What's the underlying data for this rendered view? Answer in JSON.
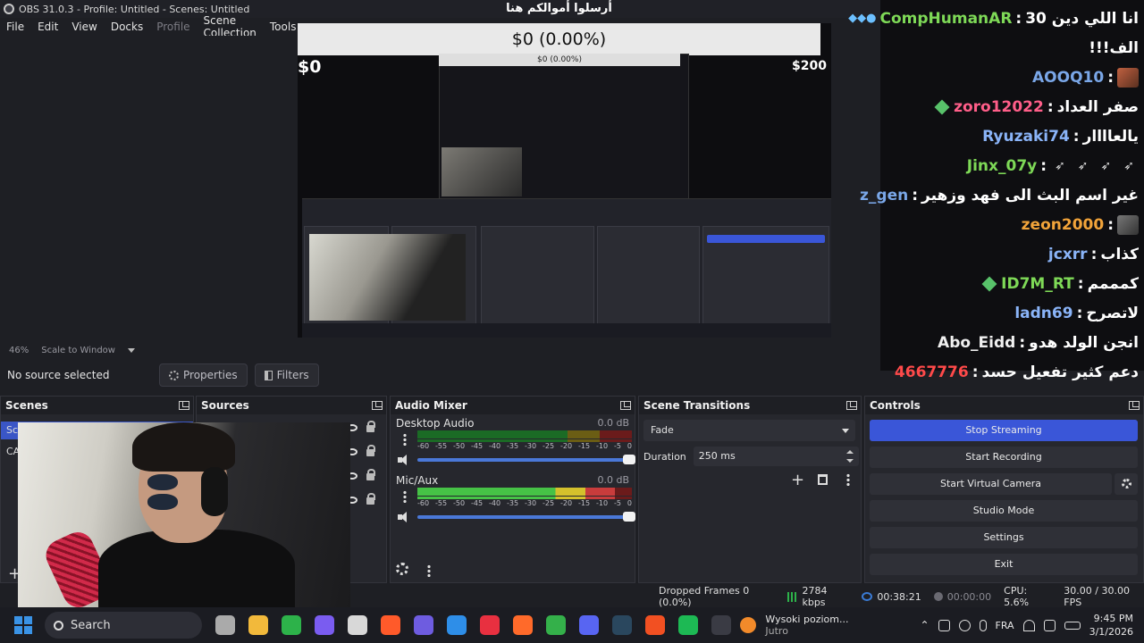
{
  "window": {
    "title": "OBS 31.0.3 - Profile: Untitled - Scenes: Untitled"
  },
  "menu": [
    "File",
    "Edit",
    "View",
    "Docks",
    "Profile",
    "Scene Collection",
    "Tools"
  ],
  "preview": {
    "donation_title": "أرسلوا أموالكم هنا",
    "donation_amount": "$0 (0.00%)",
    "min_label": "$0",
    "max_label": "$200",
    "nested_amount": "$0 (0.00%)",
    "nested_min": "$0"
  },
  "chat": [
    {
      "user": "CompHumanAR",
      "message": "انا اللي دين 30",
      "user_color": "#7ed957",
      "badges": true
    },
    {
      "user": "",
      "message": "!!!الف",
      "user_color": "#ffffff"
    },
    {
      "user": "AOOQ10",
      "message": "",
      "user_color": "#7aa7e8",
      "emote": true
    },
    {
      "user": "zoro12022",
      "message": "صفر العداد",
      "user_color": "#ff5e89",
      "gem": true
    },
    {
      "user": "Ryuzaki74",
      "message": "يالعاااار",
      "user_color": "#8ab4f8"
    },
    {
      "user": "Jinx_07y",
      "message": "",
      "user_color": "#7ed957",
      "feathers": true
    },
    {
      "user": "z_gen",
      "message": "غير اسم البث الى فهد وزهير",
      "user_color": "#7aa7e8"
    },
    {
      "user": "zeon2000",
      "message": "",
      "user_color": "#f2a43a",
      "emote_grey": true
    },
    {
      "user": "jcxrr",
      "message": "كذاب",
      "user_color": "#8ab4f8"
    },
    {
      "user": "ID7M_RT",
      "message": "كمممم",
      "user_color": "#7ed957",
      "gem": true
    },
    {
      "user": "ladn69",
      "message": "لاتصرح",
      "user_color": "#8ab4f8"
    },
    {
      "user": "Abo_Eidd",
      "message": "انجن الولد هدو",
      "user_color": "#f0f0f0"
    },
    {
      "user": "4667776",
      "message": "دعم كثير تفعيل حسد",
      "user_color": "#ff4a4a"
    }
  ],
  "zoom": {
    "percent": "46%",
    "mode": "Scale to Window"
  },
  "context": {
    "label": "No source selected",
    "properties": "Properties",
    "filters": "Filters"
  },
  "docks": {
    "scenes": {
      "title": "Scenes",
      "items": [
        "Sc",
        "CA"
      ]
    },
    "sources": {
      "title": "Sources"
    },
    "mixer": {
      "title": "Audio Mixer",
      "channels": [
        {
          "name": "Desktop Audio",
          "db": "0.0 dB",
          "level": 0.0
        },
        {
          "name": "Mic/Aux",
          "db": "0.0 dB",
          "level": 0.92
        }
      ],
      "scale": [
        "-60",
        "-55",
        "-50",
        "-45",
        "-40",
        "-35",
        "-30",
        "-25",
        "-20",
        "-15",
        "-10",
        "-5",
        "0"
      ]
    },
    "transitions": {
      "title": "Scene Transitions",
      "type": "Fade",
      "duration_label": "Duration",
      "duration": "250 ms"
    },
    "controls": {
      "title": "Controls",
      "buttons": [
        "Stop Streaming",
        "Start Recording",
        "Start Virtual Camera",
        "Studio Mode",
        "Settings",
        "Exit"
      ]
    }
  },
  "status": {
    "dropped": "Dropped Frames 0 (0.0%)",
    "bitrate": "2784 kbps",
    "live_time": "00:38:21",
    "rec_time": "00:00:00",
    "cpu": "CPU: 5.6%",
    "fps": "30.00 / 30.00 FPS"
  },
  "taskbar": {
    "search": "Search",
    "weather_line1": "Wysoki poziom...",
    "weather_line2": "Jutro",
    "lang": "FRA",
    "time": "9:45 PM",
    "date": "3/1/2026",
    "app_colors": [
      "#aaaaaa",
      "#f2b93b",
      "#2db24a",
      "#7a5cf0",
      "#d8d8d8",
      "#ff5a2a",
      "#6e5ce0",
      "#2e8ee8",
      "#e83040",
      "#ff6a2a",
      "#34b04a",
      "#5865f2",
      "#2a475e",
      "#f25022",
      "#1db954",
      "#3a3b44"
    ]
  }
}
